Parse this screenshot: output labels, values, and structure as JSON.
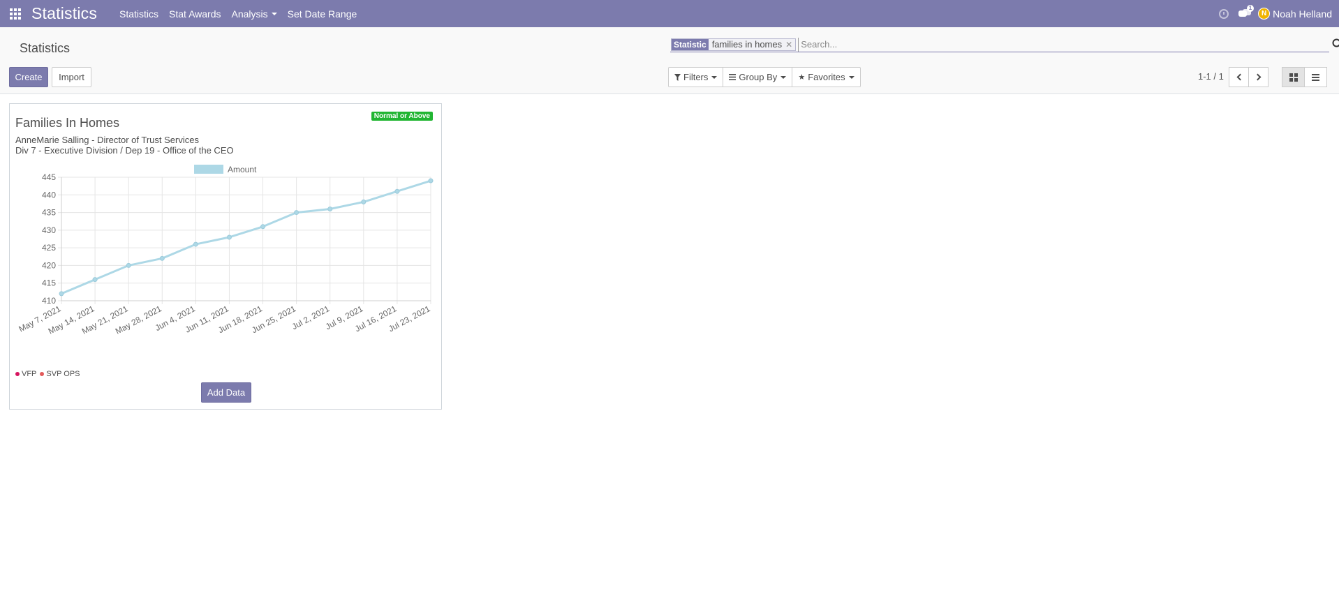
{
  "navbar": {
    "brand": "Statistics",
    "menu": [
      "Statistics",
      "Stat Awards",
      "Analysis",
      "Set Date Range"
    ],
    "message_count": "1",
    "user_initial": "N",
    "user_name": "Noah Helland",
    "color": "#7c7bad"
  },
  "control_panel": {
    "title": "Statistics",
    "search": {
      "facet_label": "Statistic",
      "facet_value": "families in homes",
      "placeholder": "Search..."
    },
    "create_label": "Create",
    "import_label": "Import",
    "filters_label": "Filters",
    "group_by_label": "Group By",
    "favorites_label": "Favorites",
    "pager_value": "1-1 / 1"
  },
  "card": {
    "title": "Families In Homes",
    "status": "Normal or Above",
    "status_color": "#21b532",
    "owner": "AnneMarie Salling - Director of Trust Services",
    "department": "Div 7 - Executive Division / Dep 19 - Office of the CEO",
    "tags": [
      {
        "label": "VFP",
        "color": "#d6145f"
      },
      {
        "label": "SVP OPS",
        "color": "#e25a5a"
      }
    ],
    "add_data_label": "Add Data"
  },
  "chart_data": {
    "type": "line",
    "legend": [
      "Amount"
    ],
    "x": [
      "May 7, 2021",
      "May 14, 2021",
      "May 21, 2021",
      "May 28, 2021",
      "Jun 4, 2021",
      "Jun 11, 2021",
      "Jun 18, 2021",
      "Jun 25, 2021",
      "Jul 2, 2021",
      "Jul 9, 2021",
      "Jul 16, 2021",
      "Jul 23, 2021"
    ],
    "series": [
      {
        "name": "Amount",
        "values": [
          412,
          416,
          420,
          422,
          426,
          428,
          431,
          435,
          436,
          438,
          441,
          444
        ],
        "color": "#add8e6"
      }
    ],
    "ylim": [
      410,
      445
    ],
    "yticks": [
      410,
      415,
      420,
      425,
      430,
      435,
      440,
      445
    ],
    "grid": true,
    "legend_position": "top"
  }
}
